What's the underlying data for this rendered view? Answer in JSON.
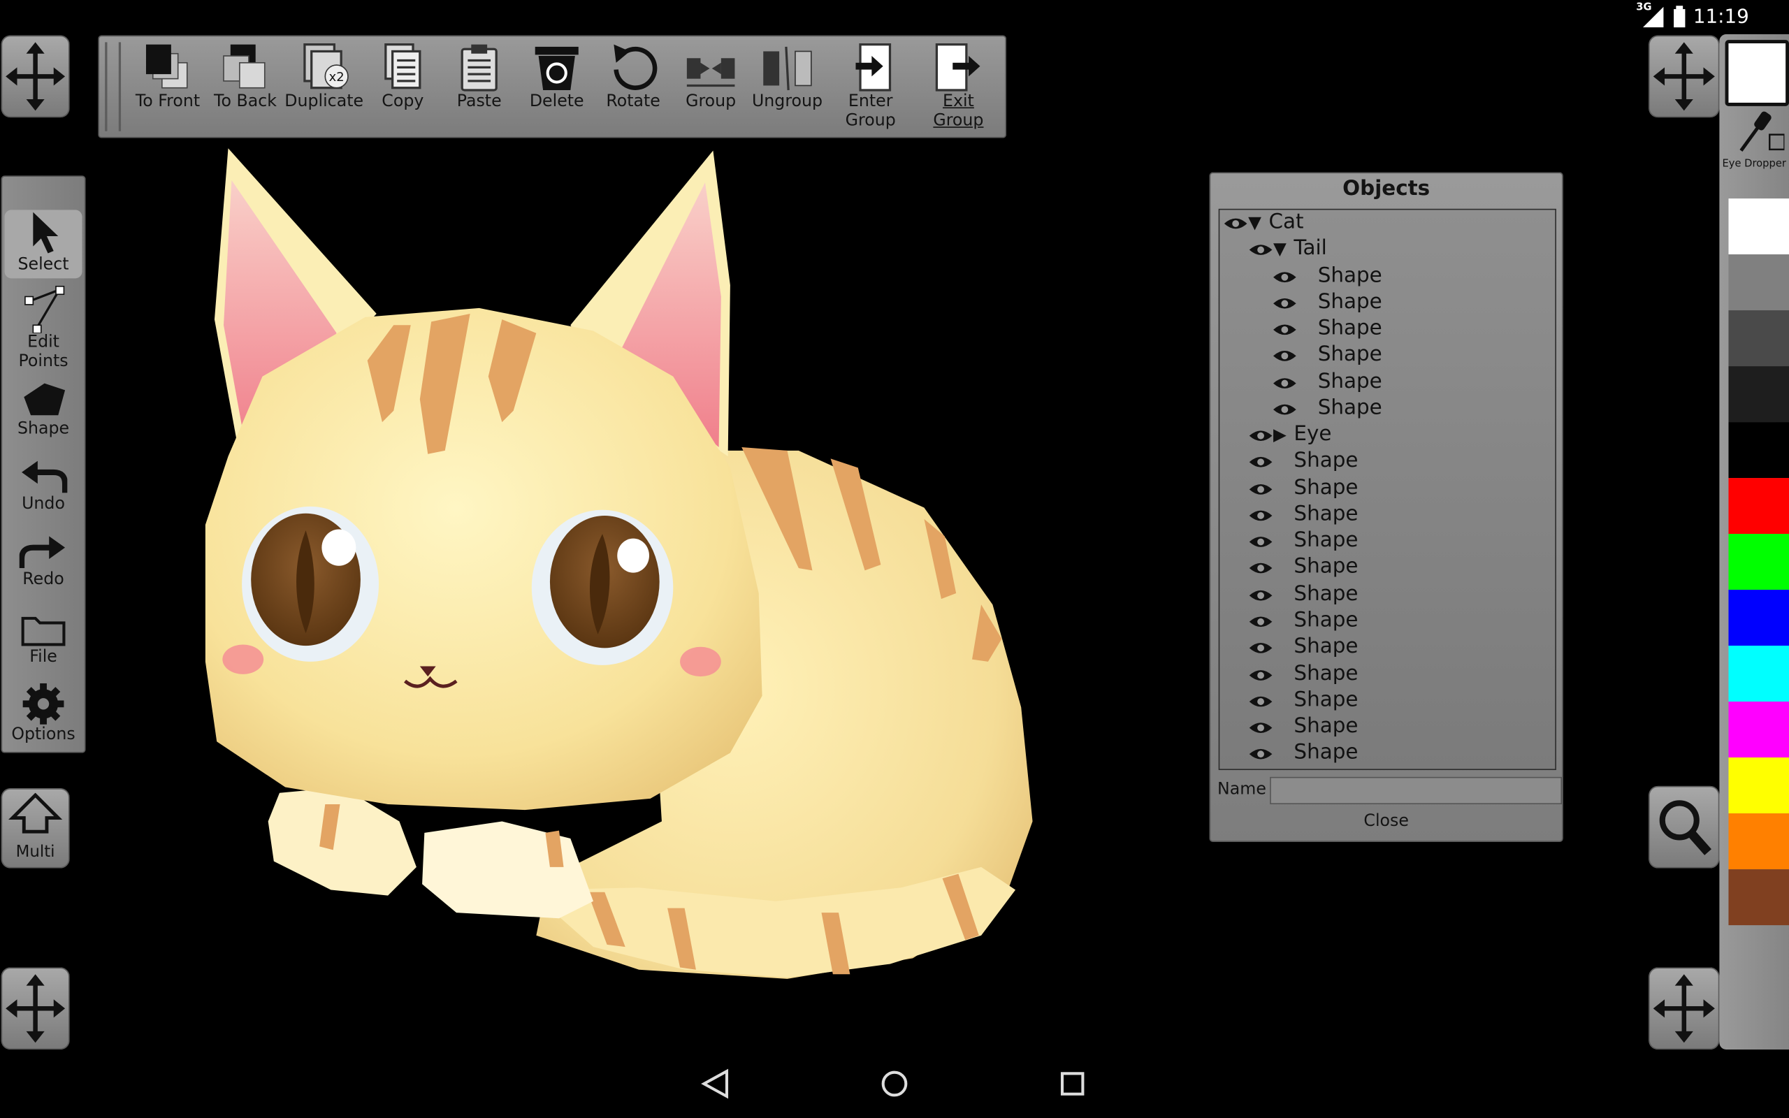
{
  "status_bar": {
    "network": "3G",
    "time": "11:19"
  },
  "toolbar": {
    "items": [
      {
        "label": "To Front",
        "icon": "to-front-icon"
      },
      {
        "label": "To Back",
        "icon": "to-back-icon"
      },
      {
        "label": "Duplicate",
        "icon": "duplicate-icon"
      },
      {
        "label": "Copy",
        "icon": "copy-icon"
      },
      {
        "label": "Paste",
        "icon": "paste-icon"
      },
      {
        "label": "Delete",
        "icon": "trash-icon"
      },
      {
        "label": "Rotate",
        "icon": "rotate-icon"
      },
      {
        "label": "Group",
        "icon": "group-icon"
      },
      {
        "label": "Ungroup",
        "icon": "ungroup-icon"
      },
      {
        "label": "Enter Group",
        "icon": "enter-group-icon"
      },
      {
        "label": "Exit Group",
        "icon": "exit-group-icon"
      }
    ],
    "duplicate_badge": "x2"
  },
  "left_tools": {
    "select": "Select",
    "edit_points": "Edit Points",
    "shape": "Shape",
    "undo": "Undo",
    "redo": "Redo",
    "file": "File",
    "options": "Options",
    "multi": "Multi"
  },
  "objects_panel": {
    "title": "Objects",
    "rows": [
      {
        "label": "Cat",
        "expander": "▼"
      },
      {
        "label": "Tail",
        "expander": "▼"
      },
      {
        "label": "Shape"
      },
      {
        "label": "Shape"
      },
      {
        "label": "Shape"
      },
      {
        "label": "Shape"
      },
      {
        "label": "Shape"
      },
      {
        "label": "Shape"
      },
      {
        "label": "Eye",
        "expander": "▶"
      },
      {
        "label": "Shape"
      },
      {
        "label": "Shape"
      },
      {
        "label": "Shape"
      },
      {
        "label": "Shape"
      },
      {
        "label": "Shape"
      },
      {
        "label": "Shape"
      },
      {
        "label": "Shape"
      },
      {
        "label": "Shape"
      },
      {
        "label": "Shape"
      },
      {
        "label": "Shape"
      },
      {
        "label": "Shape"
      },
      {
        "label": "Shape"
      }
    ],
    "name_label": "Name",
    "name_value": "",
    "close_label": "Close"
  },
  "palette": {
    "eye_dropper": "Eye Dropper",
    "current_color": "#ffffff",
    "colors": [
      "#ffffff",
      "#808080",
      "#4a4a4a",
      "#1e1e1e",
      "#000000",
      "#ff0000",
      "#00ff00",
      "#0000ff",
      "#00ffff",
      "#ff00ff",
      "#ffff00",
      "#ff8000",
      "#804020"
    ]
  }
}
